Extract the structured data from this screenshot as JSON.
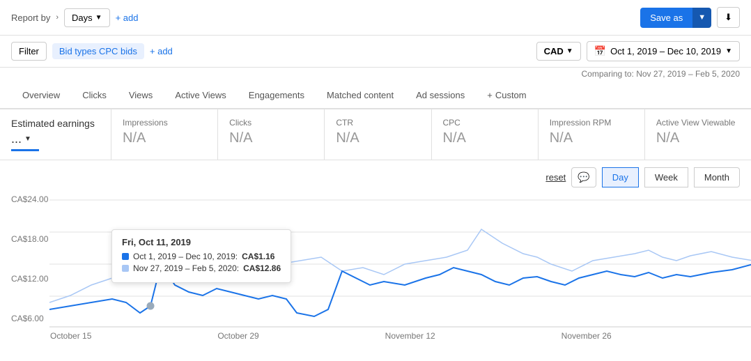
{
  "topbar": {
    "report_by_label": "Report by",
    "chevron": "›",
    "days_label": "Days",
    "days_arrow": "▼",
    "add_label": "+ add",
    "save_as_label": "Save as",
    "save_as_arrow": "▼",
    "download_icon": "⬇"
  },
  "filterbar": {
    "filter_label": "Filter",
    "filter_tag": "Bid types CPC bids",
    "add_label": "+ add",
    "currency_label": "CAD",
    "currency_arrow": "▼",
    "calendar_icon": "📅",
    "date_range": "Oct 1, 2019 – Dec 10, 2019",
    "date_arrow": "▼",
    "comparing_text": "Comparing to: Nov 27, 2019 – Feb 5, 2020"
  },
  "tabs": [
    {
      "id": "overview",
      "label": "Overview",
      "active": false
    },
    {
      "id": "clicks",
      "label": "Clicks",
      "active": false
    },
    {
      "id": "views",
      "label": "Views",
      "active": false
    },
    {
      "id": "active-views",
      "label": "Active Views",
      "active": false
    },
    {
      "id": "engagements",
      "label": "Engagements",
      "active": false
    },
    {
      "id": "matched-content",
      "label": "Matched content",
      "active": false
    },
    {
      "id": "ad-sessions",
      "label": "Ad sessions",
      "active": false
    },
    {
      "id": "custom",
      "label": "Custom",
      "active": false,
      "icon": "+"
    }
  ],
  "metrics": [
    {
      "id": "estimated-earnings",
      "label": "Estimated earnings",
      "value": "...",
      "is_main": true
    },
    {
      "id": "impressions",
      "label": "Impressions",
      "value": "N/A"
    },
    {
      "id": "clicks",
      "label": "Clicks",
      "value": "N/A"
    },
    {
      "id": "ctr",
      "label": "CTR",
      "value": "N/A"
    },
    {
      "id": "cpc",
      "label": "CPC",
      "value": "N/A"
    },
    {
      "id": "impression-rpm",
      "label": "Impression RPM",
      "value": "N/A"
    },
    {
      "id": "active-view-viewable",
      "label": "Active View Viewable",
      "value": "N/A"
    }
  ],
  "controls": {
    "reset_label": "reset",
    "comment_icon": "💬",
    "periods": [
      {
        "label": "Day",
        "active": true
      },
      {
        "label": "Week",
        "active": false
      },
      {
        "label": "Month",
        "active": false
      }
    ]
  },
  "chart": {
    "y_labels": [
      "CA$24.00",
      "CA$18.00",
      "CA$12.00",
      "CA$6.00"
    ],
    "x_labels": [
      "October 15",
      "October 29",
      "November 12",
      "November 26"
    ],
    "tooltip": {
      "title": "Fri, Oct 11, 2019",
      "rows": [
        {
          "type": "dark",
          "label": "Oct 1, 2019 – Dec 10, 2019:",
          "value": "CA$1.16"
        },
        {
          "type": "light",
          "label": "Nov 27, 2019 – Feb 5, 2020:",
          "value": "CA$12.86"
        }
      ]
    }
  }
}
